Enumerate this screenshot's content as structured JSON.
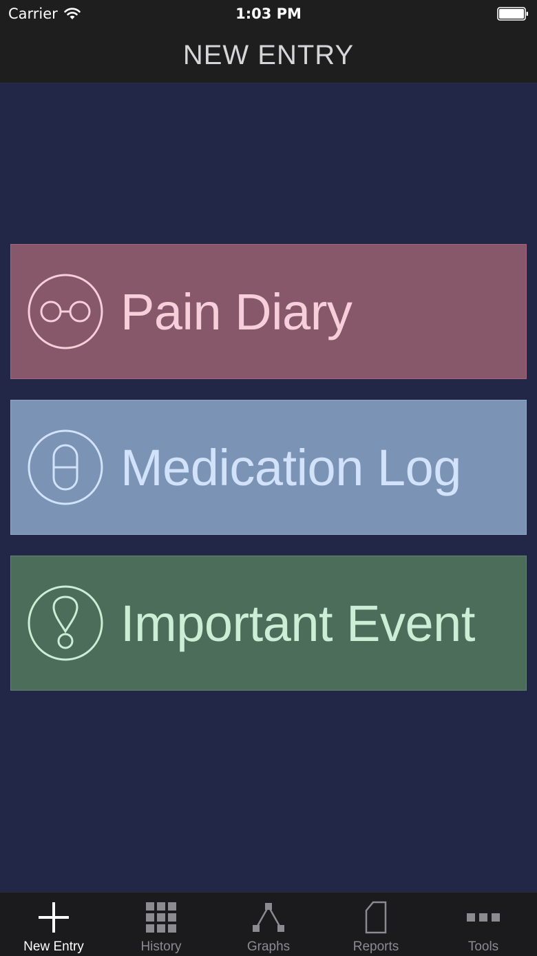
{
  "status_bar": {
    "carrier": "Carrier",
    "time": "1:03 PM"
  },
  "nav": {
    "title": "NEW ENTRY"
  },
  "entries": [
    {
      "label": "Pain Diary",
      "icon": "glasses-icon",
      "color": "#87586a"
    },
    {
      "label": "Medication Log",
      "icon": "pill-icon",
      "color": "#7b94b5"
    },
    {
      "label": "Important Event",
      "icon": "exclamation-icon",
      "color": "#4d6d5b"
    }
  ],
  "tabs": [
    {
      "label": "New Entry",
      "icon": "plus-icon",
      "active": true
    },
    {
      "label": "History",
      "icon": "grid-icon",
      "active": false
    },
    {
      "label": "Graphs",
      "icon": "graph-icon",
      "active": false
    },
    {
      "label": "Reports",
      "icon": "document-icon",
      "active": false
    },
    {
      "label": "Tools",
      "icon": "more-icon",
      "active": false
    }
  ],
  "colors": {
    "background": "#222647",
    "header": "#1e1e1e",
    "tab_bar": "#1b1b1d"
  }
}
